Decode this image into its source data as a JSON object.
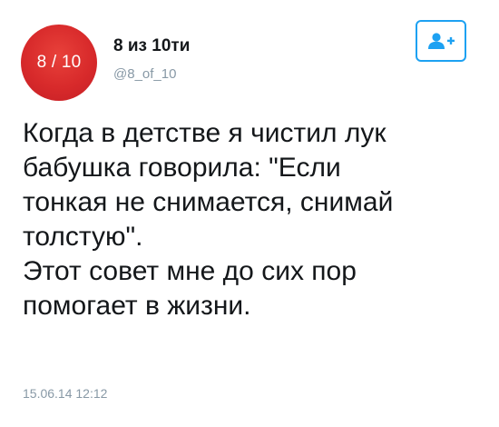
{
  "author": {
    "avatar_text": "8 / 10",
    "avatar_color": "#d82a2b",
    "display_name": "8 из 10ти",
    "handle": "@8_of_10"
  },
  "follow_button": {
    "icon": "add-user-icon",
    "color": "#1da1f2"
  },
  "tweet": {
    "lines": [
      "Когда в детстве я чистил лук",
      "бабушка говорила: \"Если",
      "тонкая не снимается, снимай",
      "толстую\".",
      "Этот совет мне до сих пор",
      "помогает в жизни."
    ],
    "timestamp": "15.06.14 12:12"
  }
}
